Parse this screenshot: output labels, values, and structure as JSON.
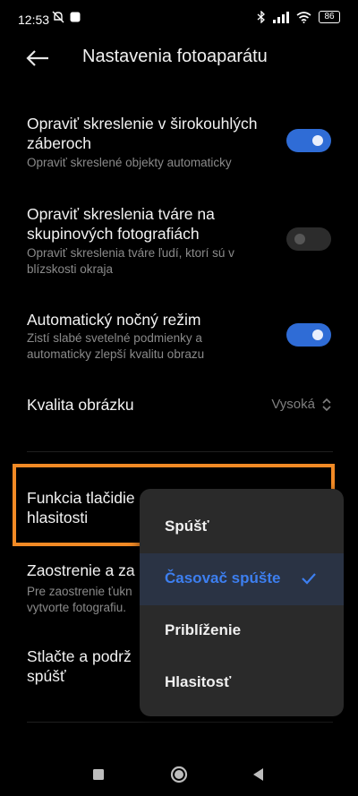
{
  "status": {
    "time": "12:53",
    "battery": "86",
    "icons": [
      "do-not-disturb-icon",
      "app-notification-icon",
      "bluetooth-icon",
      "signal-icon",
      "wifi-icon",
      "battery-icon"
    ]
  },
  "header": {
    "back_icon": "arrow-left-icon",
    "title": "Nastavenia fotoaparátu"
  },
  "settings": [
    {
      "id": "wide-angle",
      "title": "Opraviť skreslenie v širokouhlých záberoch",
      "subtitle": "Opraviť skreslené objekty automaticky",
      "toggle": true
    },
    {
      "id": "group-faces",
      "title": "Opraviť skreslenia tváre na skupinových fotografiách",
      "subtitle": "Opraviť skreslenia tváre ľudí, ktorí sú v blízskosti okraja",
      "toggle": false
    },
    {
      "id": "night-mode",
      "title": "Automatický nočný režim",
      "subtitle": "Zistí slabé svetelné podmienky a automaticky zlepší kvalitu obrazu",
      "toggle": true
    },
    {
      "id": "image-quality",
      "title": "Kvalita obrázku",
      "value": "Vysoká"
    },
    {
      "id": "volume-function",
      "title": "Funkcia tlačidie",
      "title2": "hlasitosti"
    },
    {
      "id": "tap-focus",
      "title": "Zaostrenie a za",
      "subtitle": "Pre zaostrenie ťukn",
      "subtitle2": "vytvorte fotografiu."
    },
    {
      "id": "hold-shutter",
      "title": "Stlačte a podrž",
      "title2": "spúšť"
    }
  ],
  "dropdown": {
    "items": [
      {
        "label": "Spúšť",
        "selected": false
      },
      {
        "label": "Časovač spúšte",
        "selected": true
      },
      {
        "label": "Priblíženie",
        "selected": false
      },
      {
        "label": "Hlasitosť",
        "selected": false
      }
    ]
  },
  "colors": {
    "accent": "#3d7ff0",
    "toggle_on": "#2f6cd6",
    "highlight": "#f28a25"
  }
}
